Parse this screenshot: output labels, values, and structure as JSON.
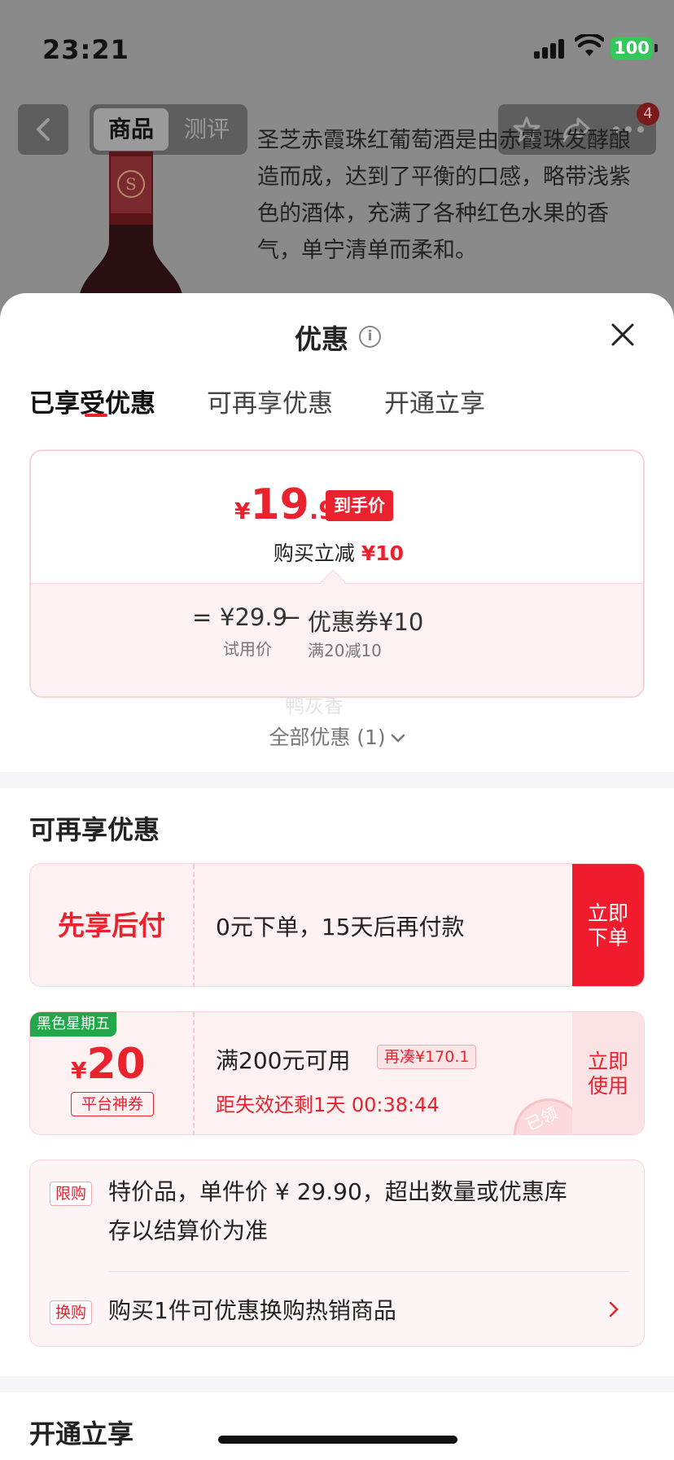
{
  "status_bar": {
    "time": "23:21",
    "battery": "100"
  },
  "nav": {
    "tab_product": "商品",
    "tab_review": "测评",
    "cart_badge": "4"
  },
  "product": {
    "description": "圣芝赤霞珠红葡萄酒是由赤霞珠发酵酿造而成，达到了平衡的口感，略带浅紫色的酒体，充满了各种红色水果的香气，单宁清单而柔和。"
  },
  "sheet": {
    "title": "优惠",
    "tabs": [
      "已享受优惠",
      "可再享优惠",
      "开通立享"
    ],
    "enjoyed": {
      "currency": "¥",
      "price_int": "19",
      "price_dec": ".9",
      "price_tag": "到手价",
      "reduce_label": "购买立减",
      "reduce_amount": "¥10",
      "eq": "=",
      "trial_price": "¥29.9",
      "minus": "−",
      "coupon_value": "优惠券¥10",
      "trial_label": "试用价",
      "coupon_cond": "满20减10",
      "watermark": "鸭灰香",
      "all_offers": "全部优惠 (1)"
    },
    "more": {
      "title": "可再享优惠",
      "pay_later": {
        "label": "先享后付",
        "text": "0元下单，15天后再付款",
        "button_l1": "立即",
        "button_l2": "下单"
      },
      "coupon": {
        "badge": "黑色星期五",
        "currency": "¥",
        "amount": "20",
        "tag": "平台神券",
        "condition": "满200元可用",
        "still_need": "再凑¥170.1",
        "countdown": "距失效还剩1天 00:38:44",
        "button_l1": "立即",
        "button_l2": "使用",
        "stamp": "已领"
      },
      "rules": [
        {
          "tag": "限购",
          "line1": "特价品，单件价 ¥ 29.90，超出数量或优惠库",
          "line2": "存以结算价为准"
        },
        {
          "tag": "换购",
          "line1": "购买1件可优惠换购热销商品"
        }
      ]
    },
    "open": {
      "title": "开通立享"
    }
  },
  "colors": {
    "accent": "#e9222e",
    "green": "#22a74a",
    "battery": "#35c759"
  }
}
